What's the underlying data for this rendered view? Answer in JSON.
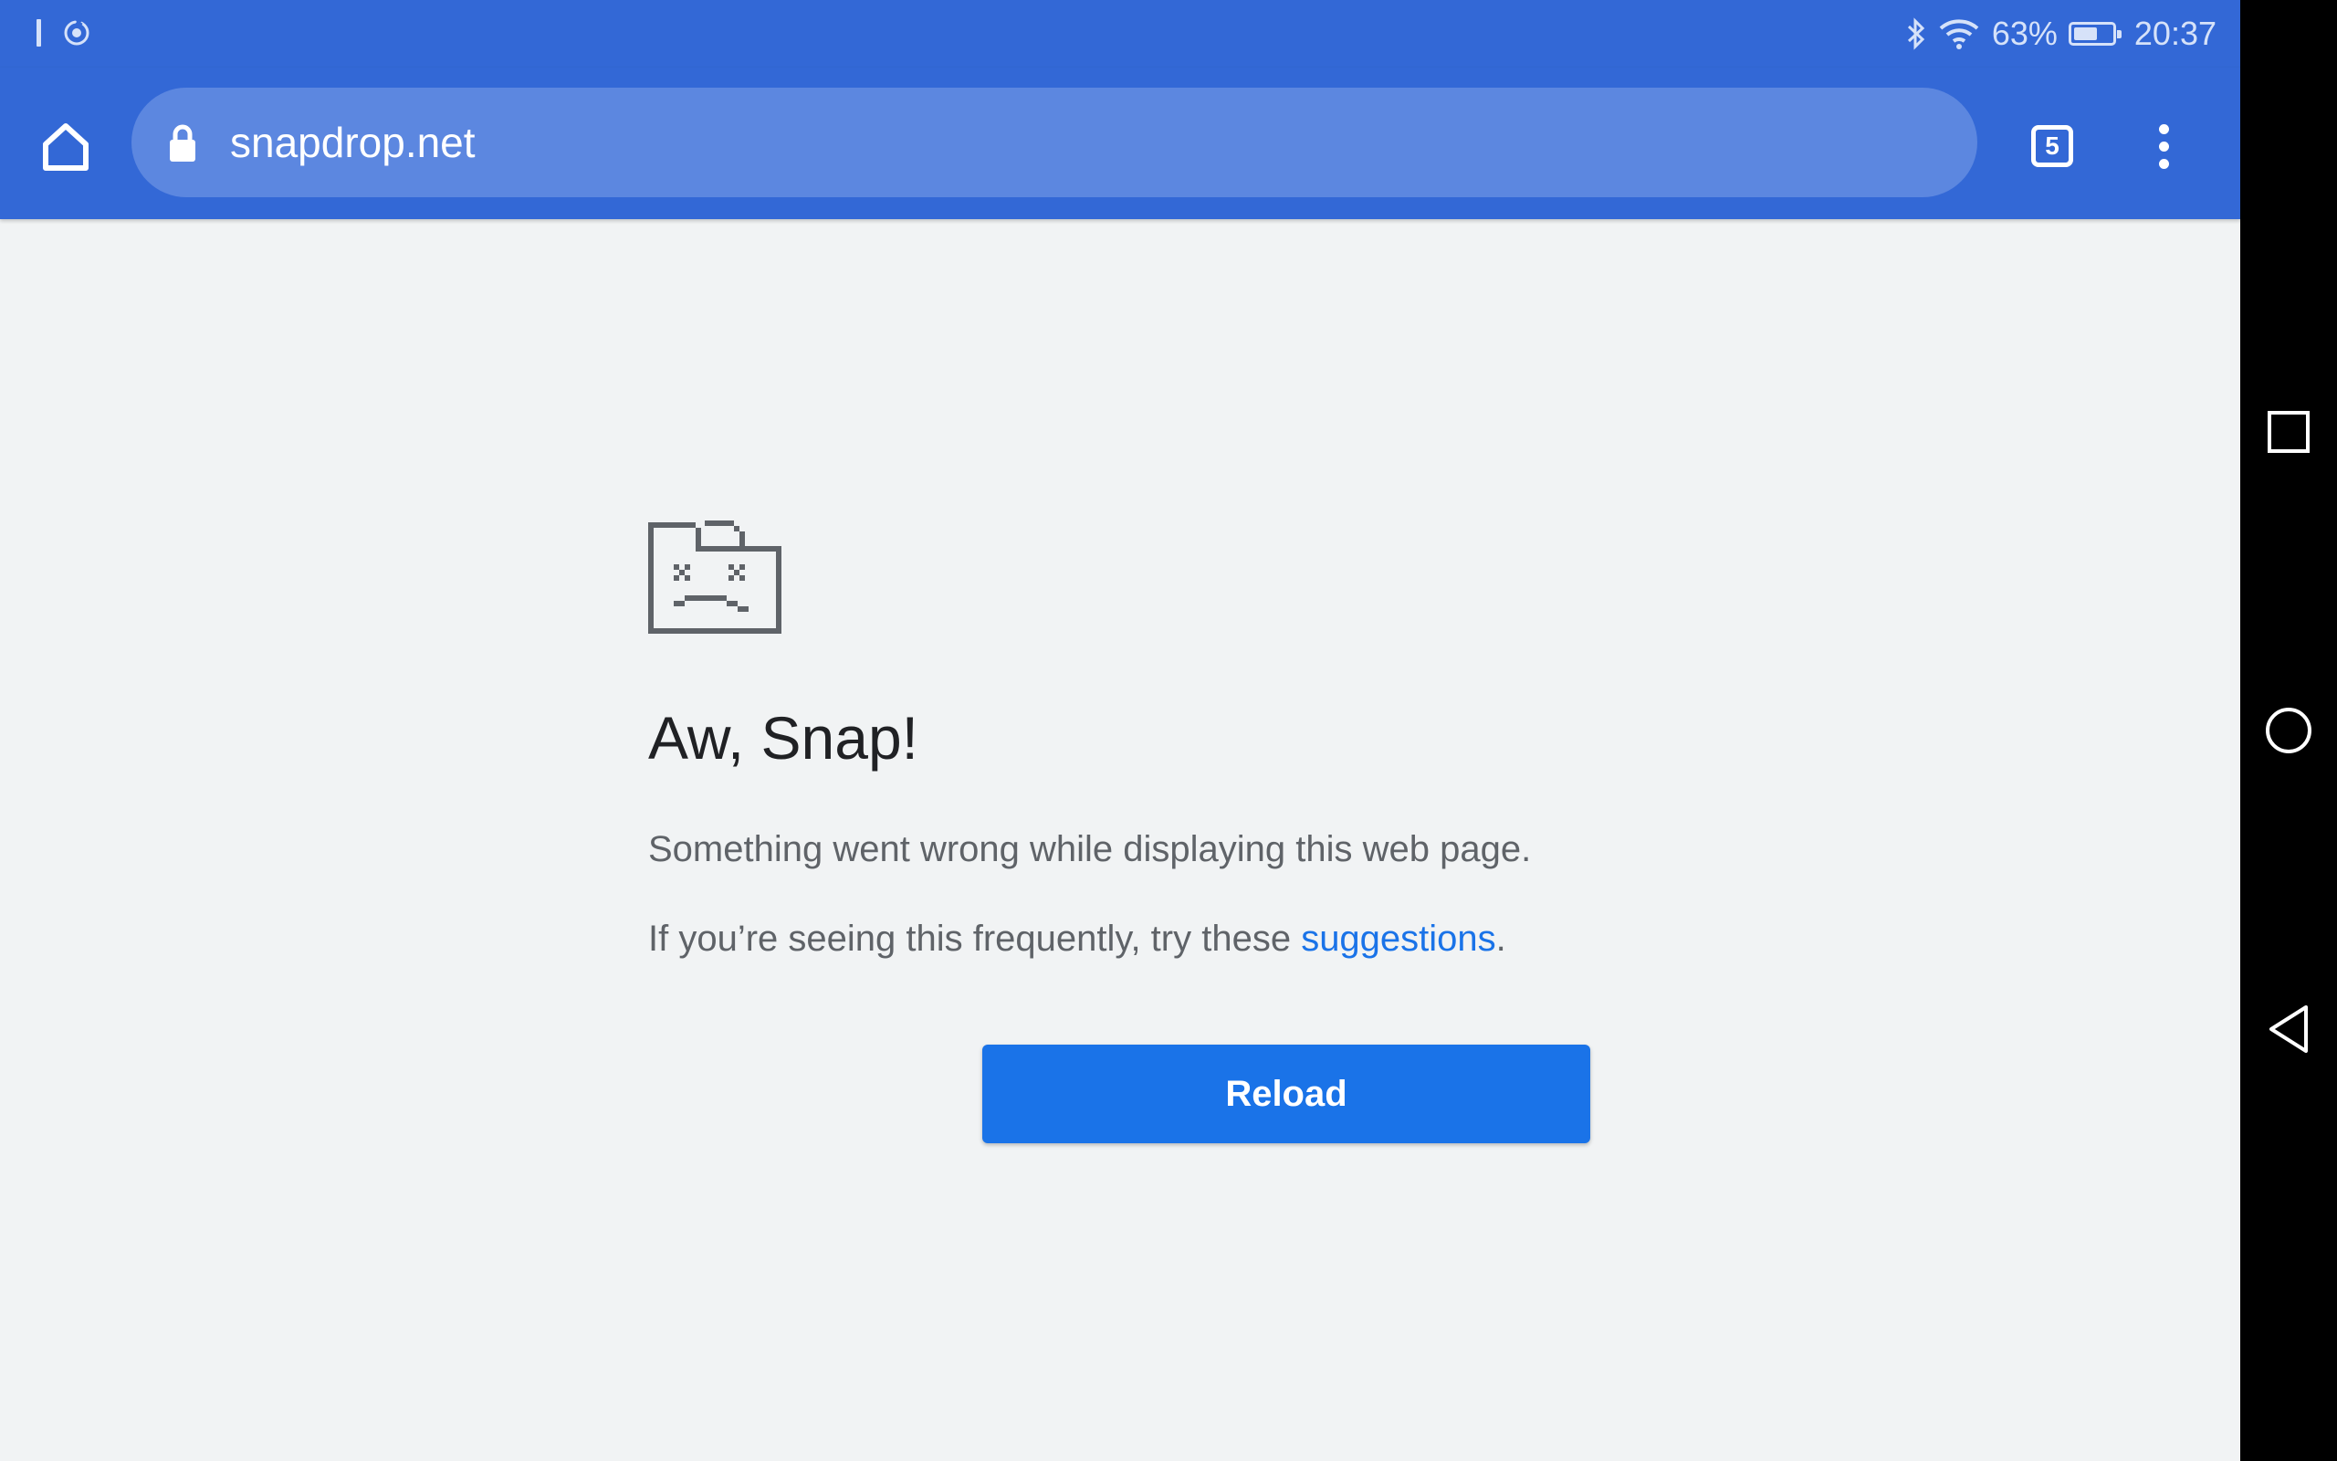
{
  "status_bar": {
    "battery_percent": "63%",
    "battery_level": 0.63,
    "time": "20:37",
    "icons": [
      "notification-bar-icon",
      "screen-rotation-icon",
      "bluetooth-icon",
      "wifi-icon",
      "battery-icon"
    ]
  },
  "toolbar": {
    "url": "snapdrop.net",
    "tab_count": "5",
    "icons": [
      "home-icon",
      "lock-icon",
      "tab-switcher-icon",
      "more-vert-icon"
    ]
  },
  "error_page": {
    "heading": "Aw, Snap!",
    "message": "Something went wrong while displaying this web page.",
    "hint_prefix": "If you’re seeing this frequently, try these ",
    "hint_link": "suggestions",
    "hint_suffix": ".",
    "reload_label": "Reload"
  },
  "colors": {
    "toolbar": "#3368d6",
    "omnibox": "#5c87e0",
    "page_background": "#f1f3f4",
    "button": "#1a73e8",
    "link": "#1a73e8"
  },
  "nav_bar": {
    "icons": [
      "recent-apps-icon",
      "home-circle-icon",
      "back-icon"
    ]
  }
}
